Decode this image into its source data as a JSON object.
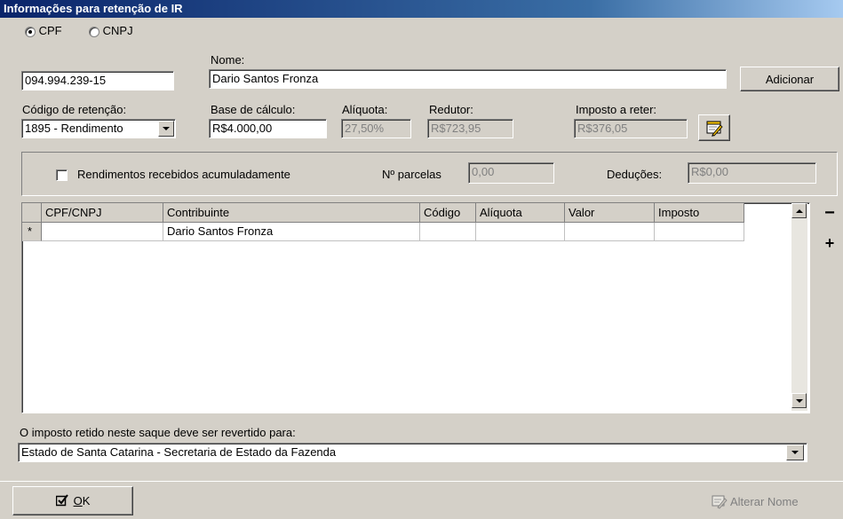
{
  "window": {
    "title": "Informações para retenção de IR"
  },
  "doc_type": {
    "options": [
      {
        "label": "CPF",
        "selected": true
      },
      {
        "label": "CNPJ",
        "selected": false
      }
    ]
  },
  "doc_number": {
    "value": "094.994.239-15"
  },
  "name": {
    "label": "Nome:",
    "value": "Dario Santos Fronza"
  },
  "add_button": {
    "label": "Adicionar"
  },
  "retention_code": {
    "label": "Código de retenção:",
    "value": "1895 - Rendimento"
  },
  "calc_base": {
    "label": "Base de cálculo:",
    "value": "R$4.000,00"
  },
  "rate": {
    "label": "Alíquota:",
    "value": "27,50%"
  },
  "reducer": {
    "label": "Redutor:",
    "value": "R$723,95"
  },
  "tax": {
    "label": "Imposto a reter:",
    "value": "R$376,05"
  },
  "cumulative": {
    "checkbox_label": "Rendimentos recebidos acumuladamente",
    "checked": false,
    "installments_label": "Nº parcelas",
    "installments_value": "0,00",
    "deductions_label": "Deduções:",
    "deductions_value": "R$0,00"
  },
  "table": {
    "columns": [
      "CPF/CNPJ",
      "Contribuinte",
      "Código",
      "Alíquota",
      "Valor",
      "Imposto"
    ],
    "new_row_marker": "*",
    "rows": [
      {
        "cpf_cnpj": "",
        "contribuinte": "Dario Santos Fronza",
        "codigo": "",
        "aliquota": "",
        "valor": "",
        "imposto": ""
      }
    ]
  },
  "side_buttons": {
    "remove": "−",
    "add": "+"
  },
  "revert": {
    "label": "O imposto retido neste saque deve ser revertido para:",
    "value": "Estado de Santa Catarina - Secretaria de Estado da Fazenda"
  },
  "footer": {
    "ok_label": "OK",
    "ok_mnemonic": "O",
    "ok_rest": "K",
    "rename_label": "Alterar Nome"
  },
  "colors": {
    "title_bar": "#0a246a",
    "face": "#d4d0c8",
    "disabled_text": "#808080"
  }
}
